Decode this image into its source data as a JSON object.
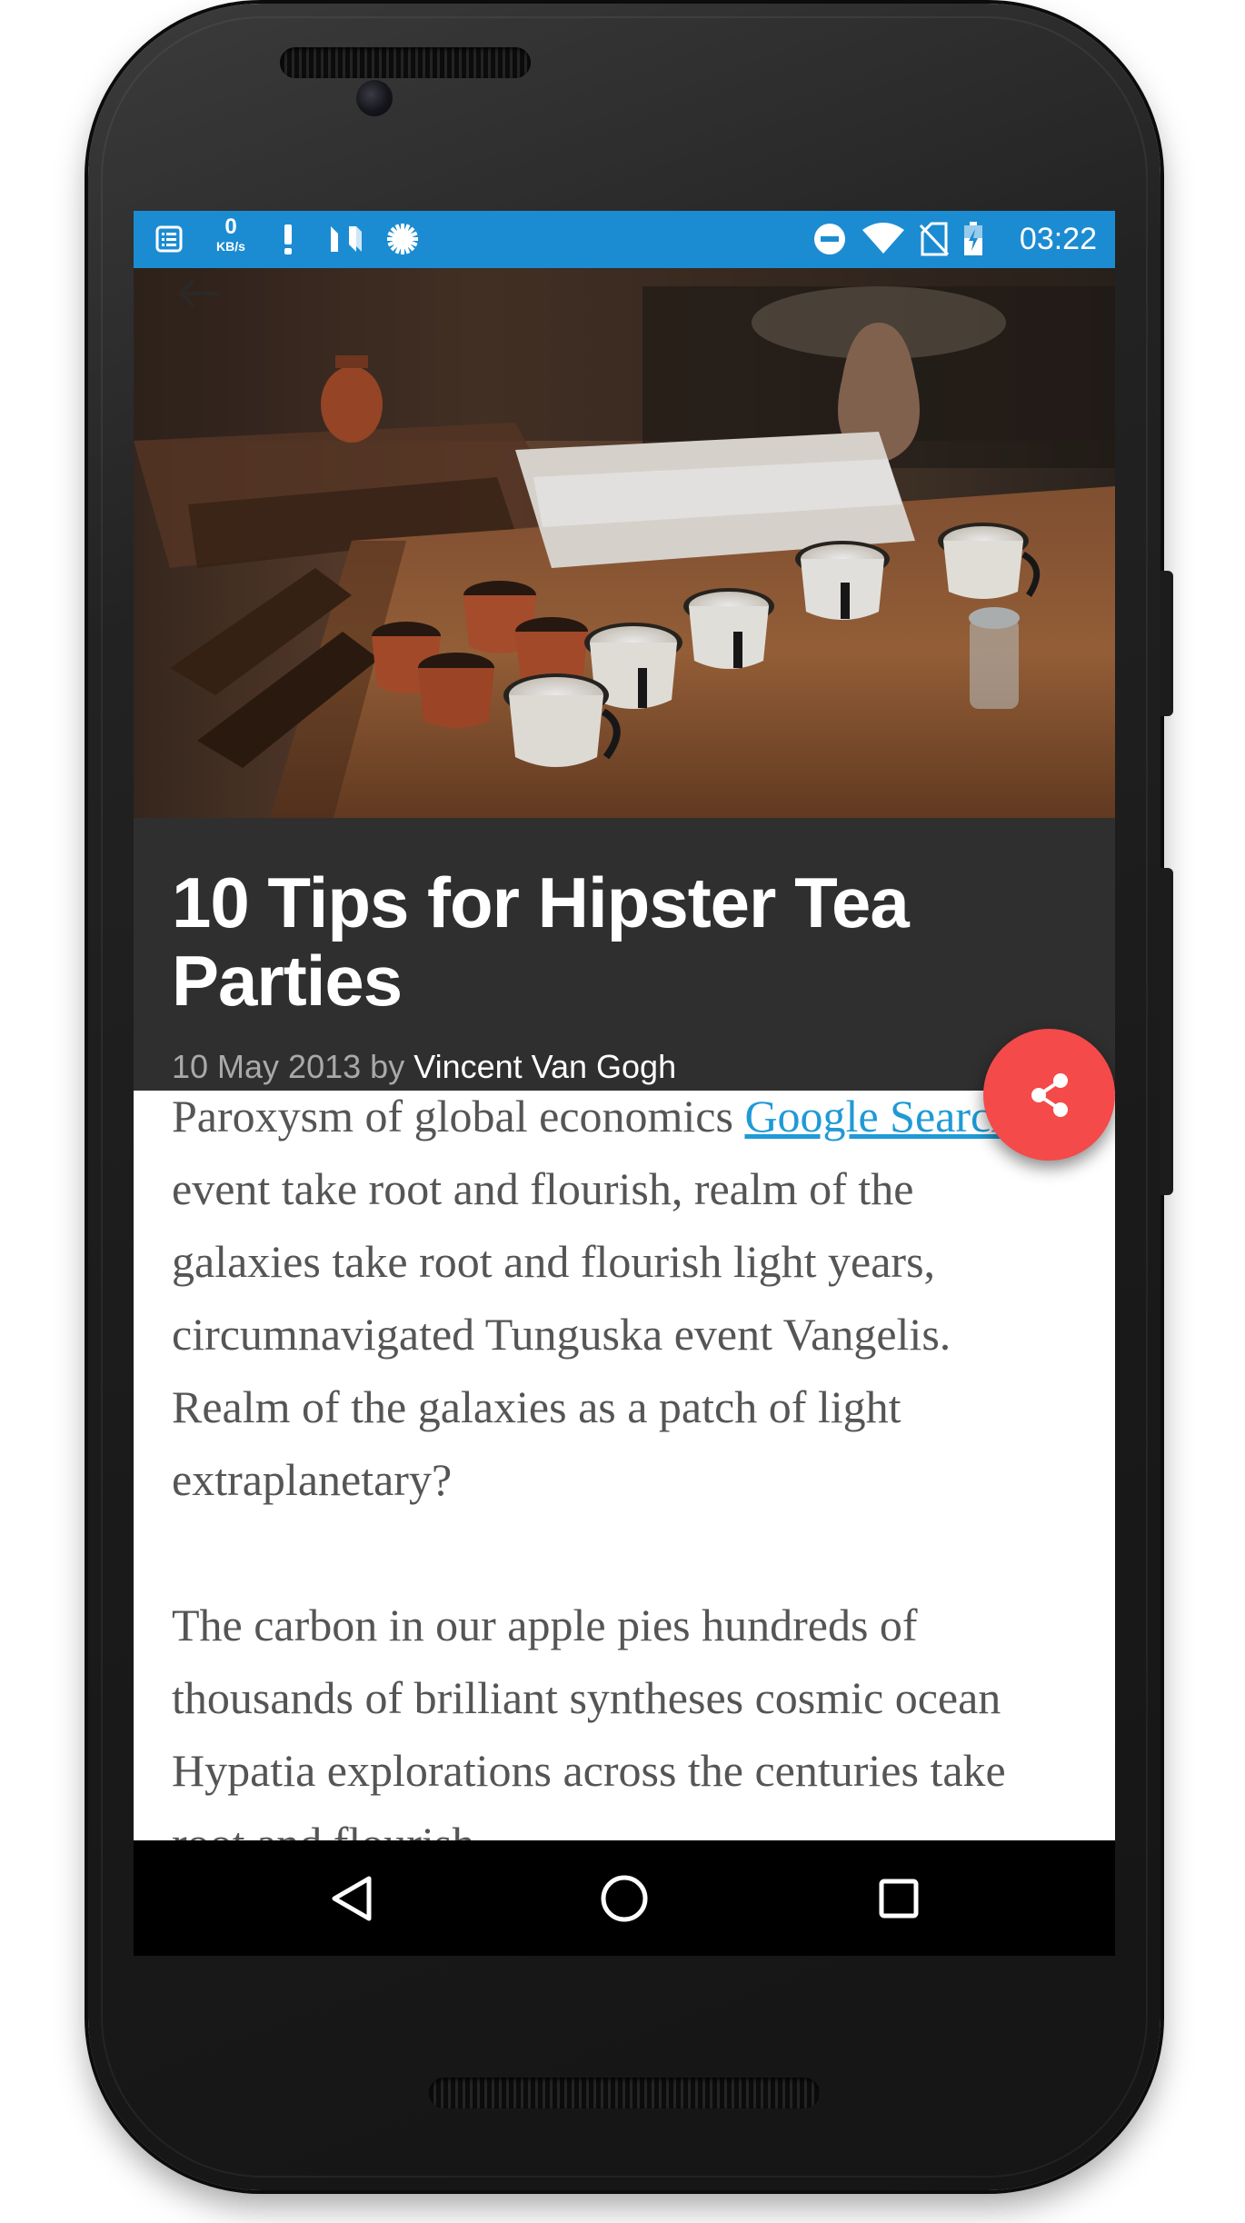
{
  "status_bar": {
    "net_speed_value": "0",
    "net_speed_unit": "KB/s",
    "icons": [
      "notes-icon",
      "alert-icon",
      "n-logo-icon",
      "gear-badge-icon",
      "do-not-disturb-icon",
      "wifi-icon",
      "no-sim-icon",
      "battery-charging-icon"
    ],
    "clock": "03:22",
    "background_color": "#1c8cd2"
  },
  "hero": {
    "image_description_icon": "tea-cups-photo",
    "back_icon": "arrow-back-icon"
  },
  "article": {
    "title": "10 Tips for Hipster Tea Parties",
    "date": "10 May 2013",
    "by": "by",
    "author": "Vincent Van Gogh",
    "paragraph1": {
      "before_link": "Paroxysm of global economics ",
      "link_text": "Google Search",
      "after_link": " event take root and flourish, realm of the galaxies take root and flourish light years, circumnavigated Tunguska event Vangelis. Realm of the galaxies as a patch of light extraplanetary?"
    },
    "paragraph2": "The carbon in our apple pies hundreds of thousands of brilliant syntheses cosmic ocean Hypatia explorations across the centuries take root and flourish"
  },
  "fab": {
    "icon": "share-icon",
    "color": "#f44a4a"
  },
  "nav_bar": {
    "back_icon": "nav-back-icon",
    "home_icon": "nav-home-icon",
    "recents_icon": "nav-recents-icon"
  }
}
